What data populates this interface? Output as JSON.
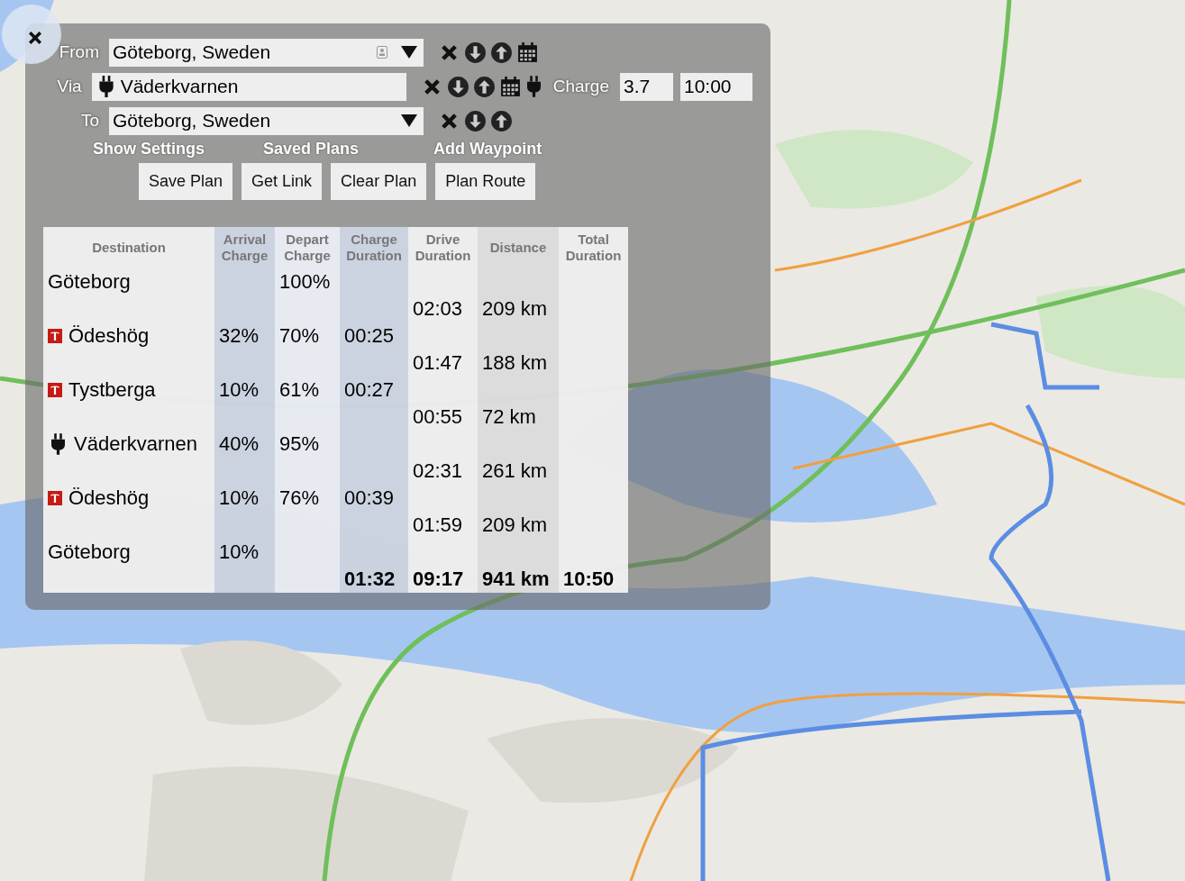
{
  "map": {
    "kind": "picture"
  },
  "route": [
    {
      "kind": "from",
      "label": "From",
      "value": "Göteborg, Sweden"
    },
    {
      "kind": "via",
      "label": "Via",
      "value": "Väderkvarnen",
      "charge_label": "Charge",
      "charge_power": "3.7",
      "charge_time": "10:00"
    },
    {
      "kind": "to",
      "label": "To",
      "value": "Göteborg, Sweden"
    }
  ],
  "links": [
    "Show Settings",
    "Saved Plans",
    "Add Waypoint"
  ],
  "buttons": [
    "Save Plan",
    "Get Link",
    "Clear Plan",
    "Plan Route"
  ],
  "table": {
    "columns": [
      "Destination",
      "Arrival Charge",
      "Depart Charge",
      "Charge Duration",
      "Drive Duration",
      "Distance",
      "Total Duration"
    ],
    "stops": [
      {
        "kind": "endpoint",
        "name": "Göteborg",
        "depart": "100%"
      },
      {
        "kind": "supercharger",
        "name": "Ödeshög",
        "arrival": "32%",
        "depart": "70%",
        "charge_duration": "00:25"
      },
      {
        "kind": "supercharger",
        "name": "Tystberga",
        "arrival": "10%",
        "depart": "61%",
        "charge_duration": "00:27"
      },
      {
        "kind": "charger",
        "name": "Väderkvarnen",
        "arrival": "40%",
        "depart": "95%"
      },
      {
        "kind": "supercharger",
        "name": "Ödeshög",
        "arrival": "10%",
        "depart": "76%",
        "charge_duration": "00:39"
      },
      {
        "kind": "endpoint",
        "name": "Göteborg",
        "arrival": "10%"
      }
    ],
    "legs": [
      {
        "drive": "02:03",
        "distance": "209 km"
      },
      {
        "drive": "01:47",
        "distance": "188 km"
      },
      {
        "drive": "00:55",
        "distance": "72 km"
      },
      {
        "drive": "02:31",
        "distance": "261 km"
      },
      {
        "drive": "01:59",
        "distance": "209 km"
      }
    ],
    "totals": {
      "charge_duration": "01:32",
      "drive": "09:17",
      "distance": "941 km",
      "total": "10:50"
    }
  }
}
